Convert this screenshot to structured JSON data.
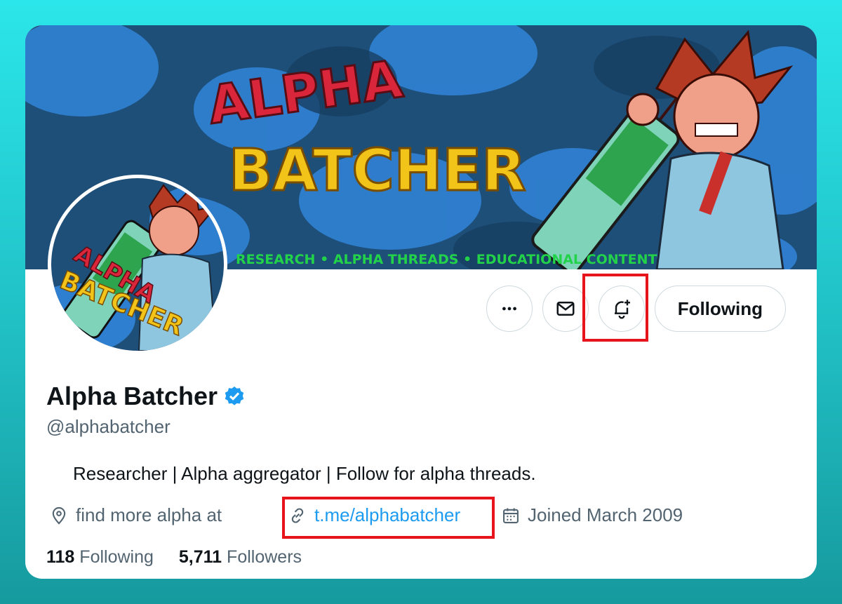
{
  "profile": {
    "name": "Alpha Batcher",
    "handle": "@alphabatcher",
    "bio": "Researcher | Alpha aggregator | Follow for alpha threads.",
    "location": "find more alpha at",
    "website": "t.me/alphabatcher",
    "joined": "Joined March 2009",
    "following_count": "118",
    "following_label": "Following",
    "followers_count": "5,711",
    "followers_label": "Followers",
    "verified_icon": "verified-badge-icon"
  },
  "banner": {
    "title_line1": "ALPHA",
    "title_line2": "BATCHER",
    "tagline": "RESEARCH • ALPHA THREADS • EDUCATIONAL CONTENT"
  },
  "avatar": {
    "text_line1": "ALPHA",
    "text_line2": "BATCHER"
  },
  "actions": {
    "more_icon": "more-icon",
    "message_icon": "envelope-icon",
    "notify_icon": "bell-plus-icon",
    "follow_label": "Following"
  },
  "colors": {
    "link": "#1d9bf0",
    "highlight": "#e8141c",
    "banner_bg": "#1d4f7a"
  }
}
